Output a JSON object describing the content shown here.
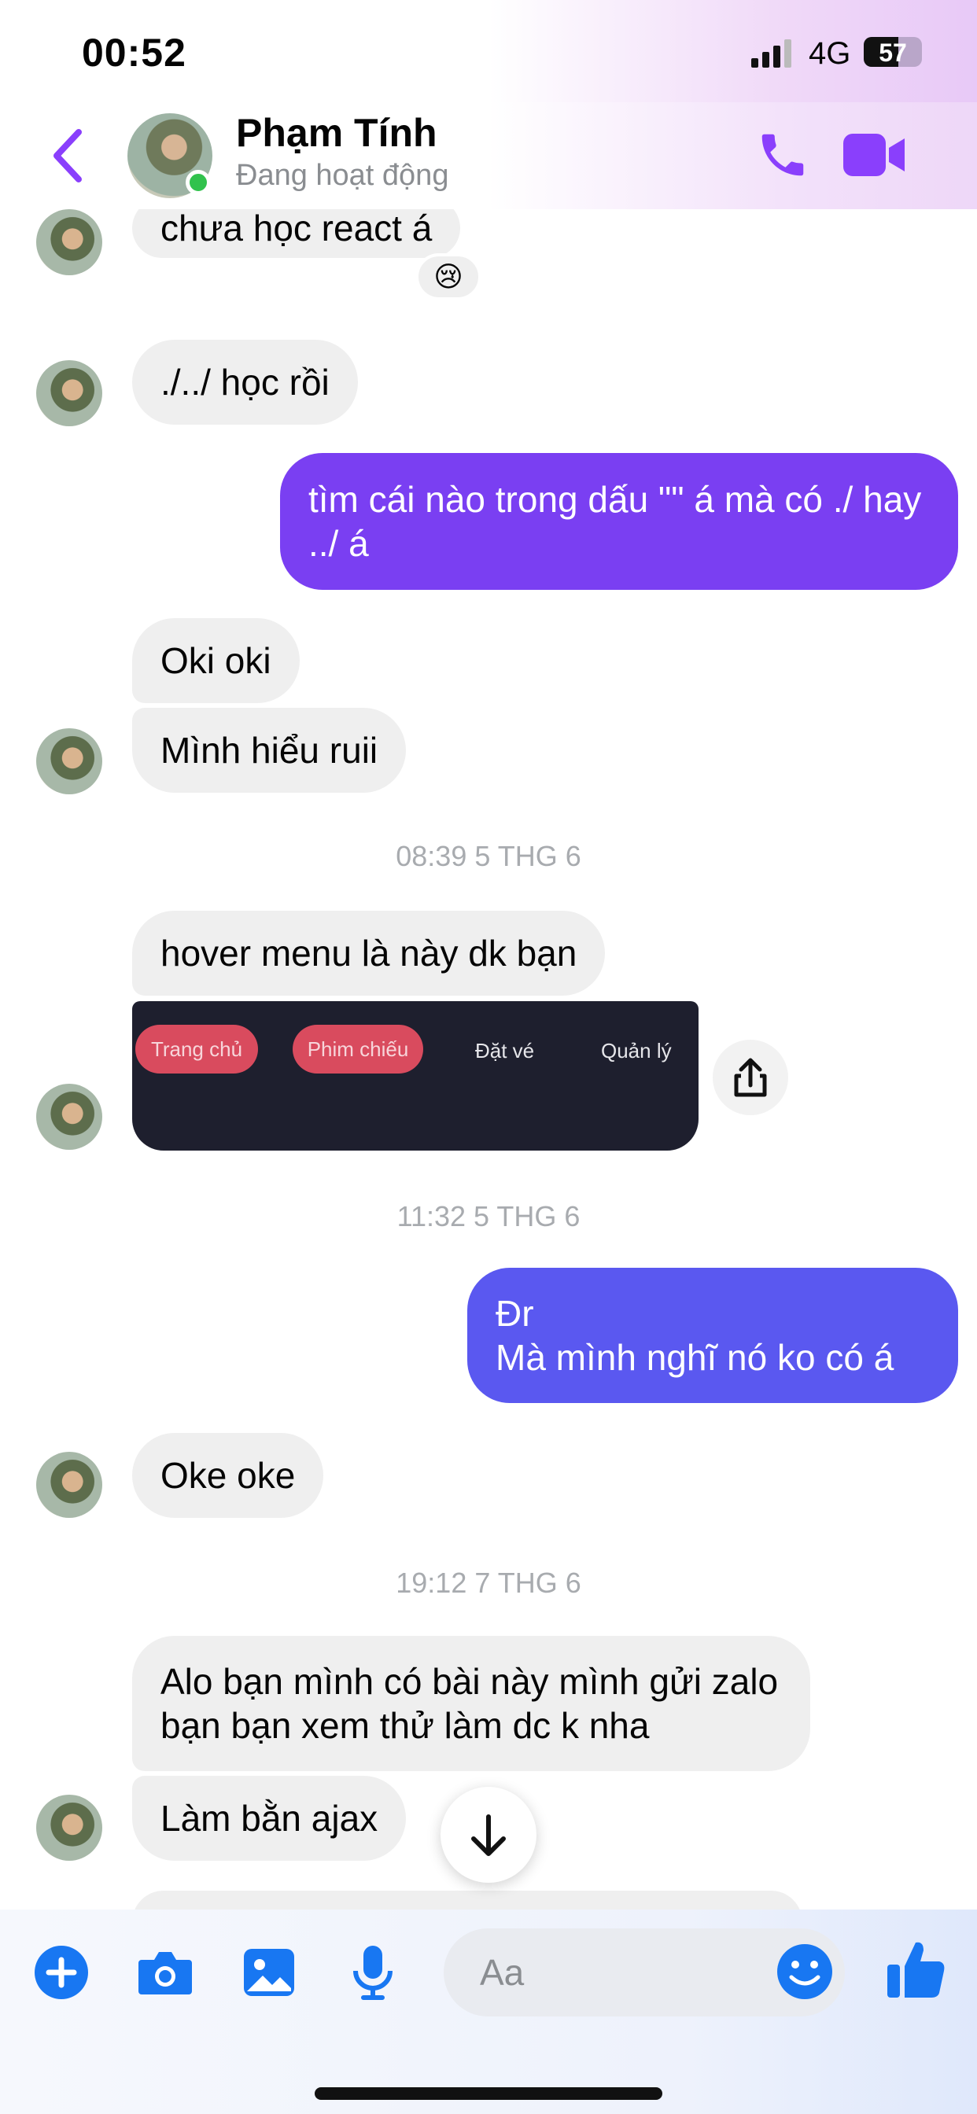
{
  "status_bar": {
    "time": "00:52",
    "network": "4G",
    "battery": "57"
  },
  "header": {
    "contact_name": "Phạm Tính",
    "presence": "Đang hoạt động"
  },
  "messages": [
    {
      "side": "in",
      "text": "chưa học react á",
      "reaction": "😢"
    },
    {
      "side": "in",
      "text": "./../ học rồi"
    },
    {
      "side": "out",
      "text": "tìm cái nào trong dấu \"\" á mà có ./ hay ../ á"
    },
    {
      "side": "in",
      "text": "Oki oki"
    },
    {
      "side": "in",
      "text": "Mình hiểu ruii"
    },
    {
      "side": "stamp",
      "text": "08:39 5 THG 6"
    },
    {
      "side": "in",
      "text": "hover menu là này dk bạn"
    },
    {
      "side": "in",
      "type": "image",
      "menu_items": [
        "Trang chủ",
        "Phim chiếu",
        "Đặt vé",
        "Quản lý"
      ]
    },
    {
      "side": "stamp",
      "text": "11:32 5 THG 6"
    },
    {
      "side": "out",
      "text": "Đr\nMà mình nghĩ nó ko có á"
    },
    {
      "side": "in",
      "text": "Oke oke"
    },
    {
      "side": "stamp",
      "text": "19:12 7 THG 6"
    },
    {
      "side": "in",
      "text": "Alo bạn mình có bài này mình gửi zalo bạn bạn xem thử làm dc k nha"
    },
    {
      "side": "in",
      "text": "Làm bằn ajax"
    }
  ],
  "composer": {
    "placeholder": "Aa"
  },
  "icons": [
    "back-icon",
    "phone-icon",
    "video-icon",
    "share-icon",
    "arrow-down-icon",
    "plus-icon",
    "camera-icon",
    "gallery-icon",
    "mic-icon",
    "emoji-icon",
    "like-icon"
  ],
  "colors": {
    "accent": "#8a3ffc",
    "out_bubble_1": "#7a3ff2",
    "out_bubble_2": "#5a58f0",
    "online": "#31c24d"
  }
}
